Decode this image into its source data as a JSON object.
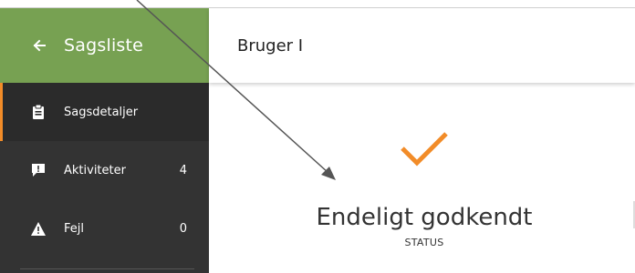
{
  "sidebar": {
    "back_label": "Sagsliste",
    "items": [
      {
        "label": "Sagsdetaljer",
        "count": "",
        "icon": "clipboard-icon",
        "active": true
      },
      {
        "label": "Aktiviteter",
        "count": "4",
        "icon": "chat-alert-icon",
        "active": false
      },
      {
        "label": "Fejl",
        "count": "0",
        "icon": "warning-icon",
        "active": false
      }
    ]
  },
  "header": {
    "title": "Bruger I"
  },
  "main": {
    "status_value": "Endeligt godkendt",
    "status_label": "STATUS",
    "status_icon": "checkmark-icon"
  },
  "colors": {
    "sidebar_bg": "#333333",
    "sidebar_header_bg": "#77a152",
    "accent": "#f28c28"
  }
}
